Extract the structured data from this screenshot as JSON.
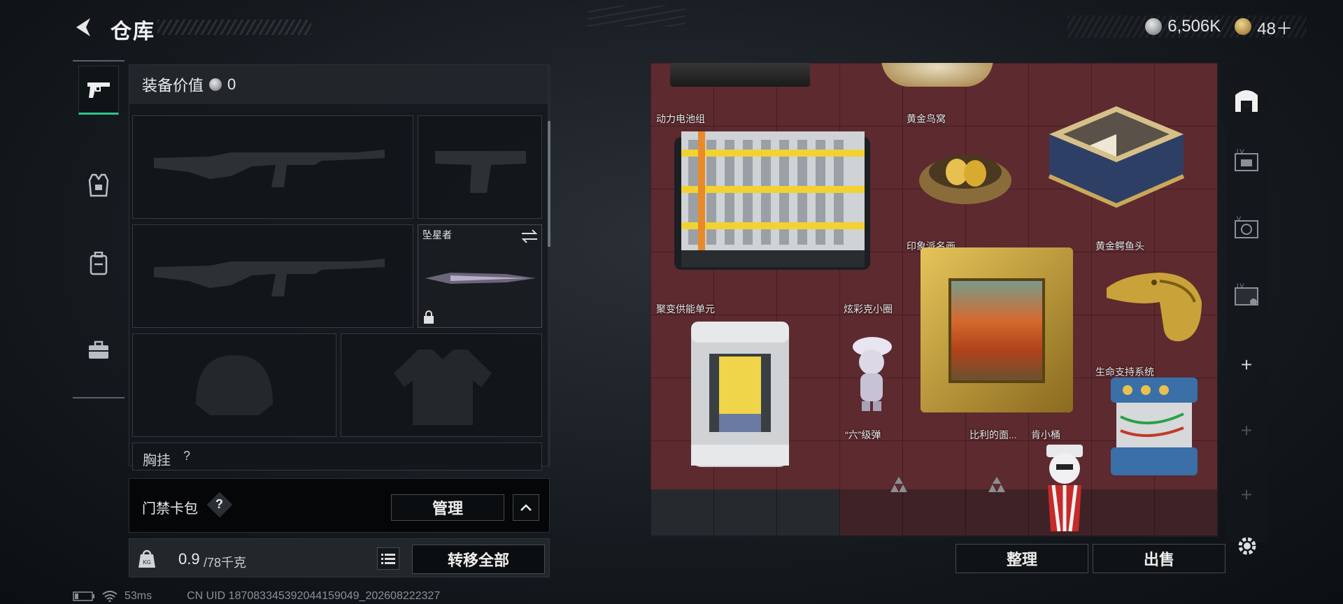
{
  "header": {
    "title": "仓库",
    "currency": [
      {
        "icon": "silver-coin-icon",
        "value": "6,506K"
      },
      {
        "icon": "gold-coin-icon",
        "value": "48＋"
      }
    ]
  },
  "tabs": [
    {
      "icon": "pistol-icon",
      "active": true
    },
    {
      "icon": "vest-icon",
      "active": false
    },
    {
      "icon": "backpack-icon",
      "active": false
    },
    {
      "icon": "briefcase-icon",
      "active": false
    }
  ],
  "equipment": {
    "value_label": "装备价值",
    "value": "0",
    "melee_name": "坠星者",
    "chest_label": "胸挂",
    "chest_hint": "?"
  },
  "card_bar": {
    "label": "门禁卡包",
    "help": "?",
    "manage_label": "管理"
  },
  "weight": {
    "current": "0.9",
    "capacity": "/78千克",
    "transfer_all_label": "转移全部"
  },
  "status": {
    "ping": "53ms",
    "uid": "CN UID 187083345392044159049_202608222327"
  },
  "stash": {
    "items": [
      {
        "name": "动力电池组"
      },
      {
        "name": "黄金鸟窝"
      },
      {
        "name": "印象派名画"
      },
      {
        "name": "黄金鳄鱼头"
      },
      {
        "name": "聚变供能单元"
      },
      {
        "name": "炫彩克小圈"
      },
      {
        "name": "生命支持系统"
      },
      {
        "name": "“六”级弹"
      },
      {
        "name": "比利的面..."
      },
      {
        "name": "肯小桶"
      }
    ],
    "sort_label": "整理",
    "sell_label": "出售"
  },
  "colors": {
    "accent_green": "#2ec58a",
    "stash_bg": "#5d2a2f"
  }
}
